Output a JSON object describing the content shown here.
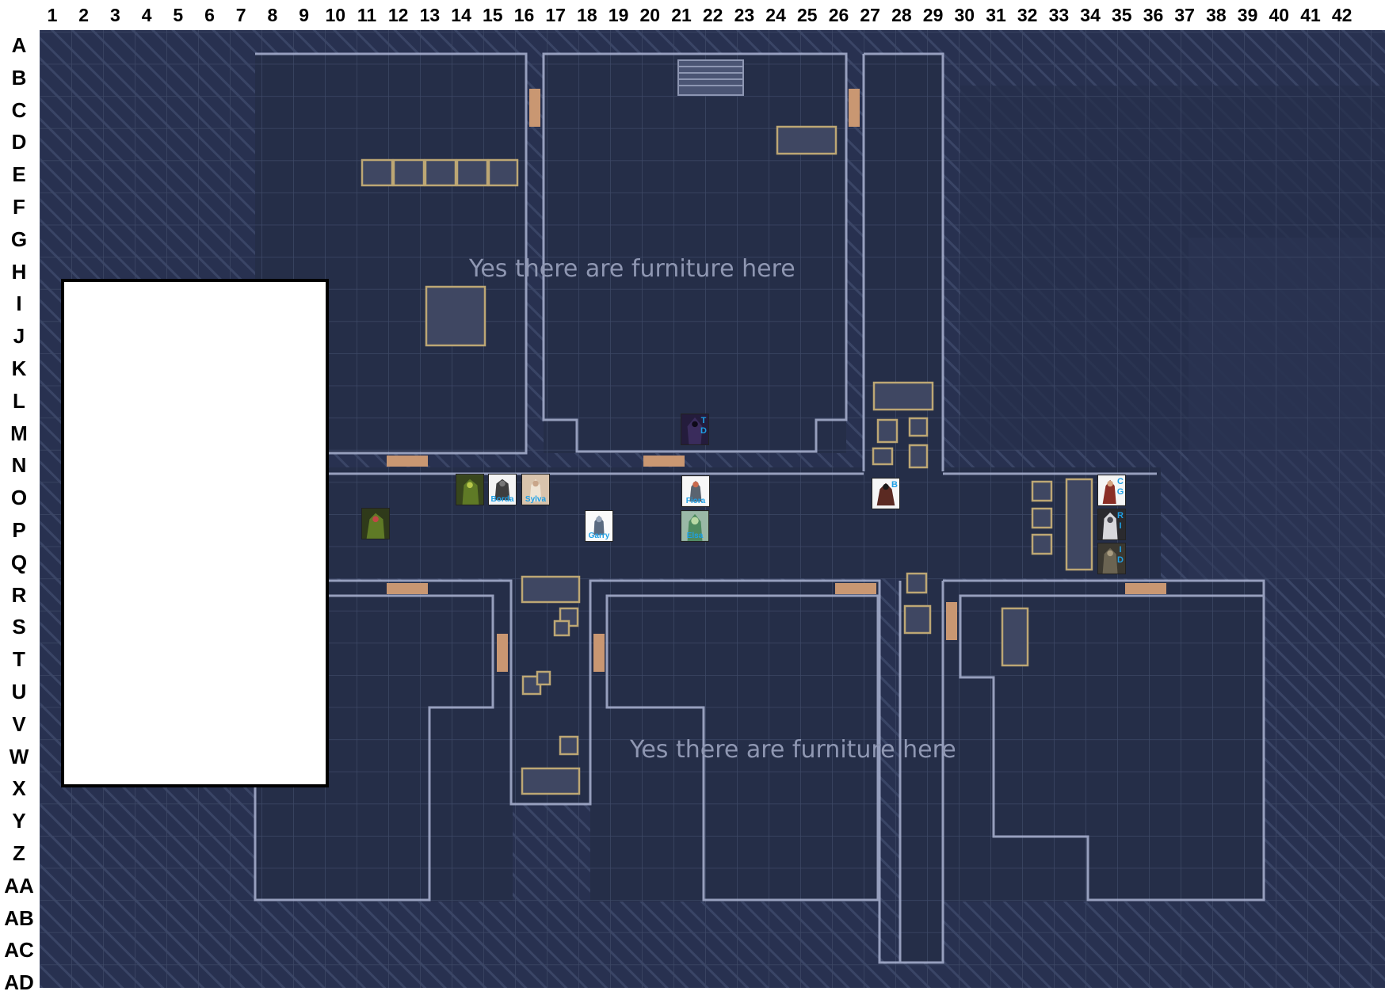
{
  "map": {
    "columns": [
      "1",
      "2",
      "3",
      "4",
      "5",
      "6",
      "7",
      "8",
      "9",
      "10",
      "11",
      "12",
      "13",
      "14",
      "15",
      "16",
      "17",
      "18",
      "19",
      "20",
      "21",
      "22",
      "23",
      "24",
      "25",
      "26",
      "27",
      "28",
      "29",
      "30",
      "31",
      "32",
      "33",
      "34",
      "35",
      "36",
      "37",
      "38",
      "39",
      "40",
      "41",
      "42"
    ],
    "rows": [
      "A",
      "B",
      "C",
      "D",
      "E",
      "F",
      "G",
      "H",
      "I",
      "J",
      "K",
      "L",
      "M",
      "N",
      "O",
      "P",
      "Q",
      "R",
      "S",
      "T",
      "U",
      "V",
      "W",
      "X",
      "Y",
      "Z",
      "AA",
      "AB",
      "AC",
      "AD"
    ],
    "notes": [
      "Yes there are furniture here",
      "Yes there are furniture here"
    ],
    "colors": {
      "floor": "#252e48",
      "grid_line": "#3d4866",
      "wall": "#aab3d2",
      "furniture": "#bda774",
      "door": "#c99772",
      "token_label": "#1ea0e6"
    }
  },
  "tokens": [
    {
      "name": "dark-hooded-figure",
      "label": "",
      "side": "T D",
      "icon": "hooded-figure-icon"
    },
    {
      "name": "green-monster-1",
      "label": "",
      "side": "",
      "icon": "green-monster-icon"
    },
    {
      "name": "armored-warrior",
      "label": "Borda",
      "side": "",
      "icon": "armored-warrior-icon"
    },
    {
      "name": "pale-figure",
      "label": "Sylva",
      "side": "",
      "icon": "pale-figure-icon"
    },
    {
      "name": "robed-figure",
      "label": "Fiora",
      "side": "",
      "icon": "robed-figure-icon"
    },
    {
      "name": "bearded-figure",
      "label": "",
      "side": "B",
      "icon": "bearded-figure-icon"
    },
    {
      "name": "green-monster-2",
      "label": "",
      "side": "",
      "icon": "green-monster-icon"
    },
    {
      "name": "knight-figure",
      "label": "Garry",
      "side": "",
      "icon": "knight-icon"
    },
    {
      "name": "green-elf",
      "label": "Elsa",
      "side": "",
      "icon": "green-elf-icon"
    },
    {
      "name": "red-robed-figure",
      "label": "",
      "side": "C G",
      "icon": "red-robed-icon"
    },
    {
      "name": "white-haired-figure",
      "label": "",
      "side": "R I",
      "icon": "white-haired-icon"
    },
    {
      "name": "dark-rogue",
      "label": "",
      "side": "I D",
      "icon": "rogue-icon"
    }
  ]
}
